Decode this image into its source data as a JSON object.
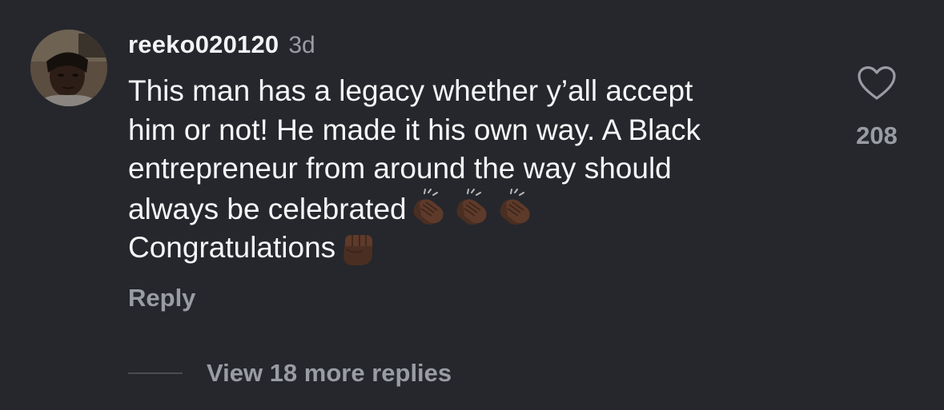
{
  "comment": {
    "username": "reeko020120",
    "time": "3d",
    "lines": [
      "This man has a legacy whether y’all accept",
      "him or not! He made it his own way. A Black",
      "entrepreneur from around the way should",
      "always be celebrated",
      "Congratulations"
    ],
    "emoji": {
      "line4": [
        "clapping-hands-dark-skin-tone",
        "clapping-hands-dark-skin-tone",
        "clapping-hands-dark-skin-tone"
      ],
      "line5": [
        "raised-fist-dark-skin-tone"
      ]
    },
    "like_count": "208",
    "reply_label": "Reply",
    "view_replies_label": "View 18 more replies"
  },
  "colors": {
    "background": "#25272c",
    "primary_text": "#f5f6f8",
    "secondary_text": "#9a9ca3"
  },
  "icons": {
    "like": "heart-outline-icon"
  }
}
